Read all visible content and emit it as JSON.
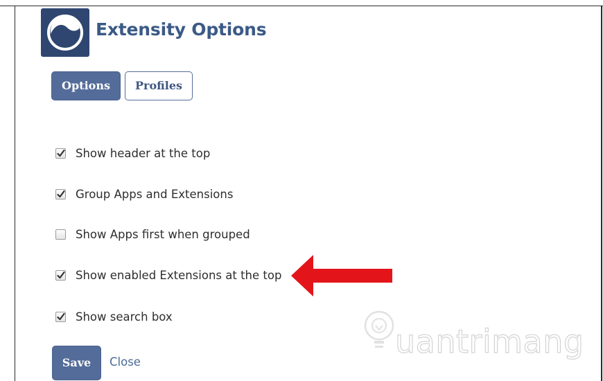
{
  "header": {
    "title": "Extensity Options",
    "logo_icon": "extensity-logo-icon"
  },
  "tabs": [
    {
      "label": "Options",
      "active": true
    },
    {
      "label": "Profiles",
      "active": false
    }
  ],
  "options": [
    {
      "label": "Show header at the top",
      "checked": true
    },
    {
      "label": "Group Apps and Extensions",
      "checked": true
    },
    {
      "label": "Show Apps first when grouped",
      "checked": false
    },
    {
      "label": "Show enabled Extensions at the top",
      "checked": true
    },
    {
      "label": "Show search box",
      "checked": true
    }
  ],
  "footer": {
    "save_label": "Save",
    "close_label": "Close"
  },
  "watermark": {
    "text": "uantrimang"
  },
  "colors": {
    "accent": "#546c99",
    "title": "#3b5a86",
    "arrow": "#e3151a"
  }
}
